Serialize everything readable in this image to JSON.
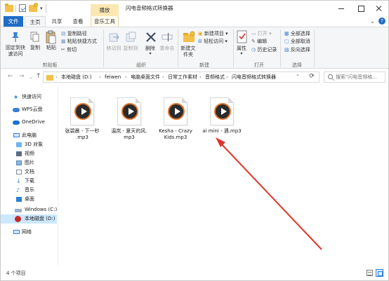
{
  "window": {
    "context_tab": "播放",
    "title": "闪电音频格式转换器"
  },
  "tabs": [
    "文件",
    "主页",
    "共享",
    "查看",
    "音乐工具"
  ],
  "ribbon": {
    "clipboard": {
      "pin_label": "固定到快速访问",
      "copy_label": "复制",
      "paste_label": "粘贴",
      "copy_path": "复制路径",
      "paste_shortcut": "粘贴快捷方式",
      "cut": "剪切",
      "group": "剪贴板"
    },
    "organize": {
      "move_to": "移动到",
      "copy_to": "复制到",
      "delete": "删除",
      "rename": "重命名",
      "group": "组织"
    },
    "new": {
      "new_folder": "新建文件夹",
      "new_item": "新建项目",
      "easy_access": "轻松访问",
      "group": "新建"
    },
    "open": {
      "properties": "属性",
      "open": "打开",
      "edit": "编辑",
      "history": "历史记录",
      "group": "打开"
    },
    "select": {
      "select_all": "全部选择",
      "select_none": "全部取消",
      "invert": "反向选择",
      "group": "选择"
    }
  },
  "address": {
    "crumbs": [
      "本地磁盘 (D:)",
      "feiwen",
      "电脑桌面文件",
      "日常工作素材",
      "音频格式",
      "闪电音频格式转换器"
    ],
    "search_placeholder": "搜索\"闪电音频格..."
  },
  "nav": {
    "items": [
      {
        "label": "快速访问",
        "icon": "star-icon"
      },
      {
        "label": "WPS云盘",
        "icon": "cloud-icon"
      },
      {
        "label": "OneDrive",
        "icon": "onedrive-icon"
      },
      {
        "label": "此电脑",
        "icon": "computer-icon"
      },
      {
        "label": "3D 对象",
        "icon": "cube-icon"
      },
      {
        "label": "视频",
        "icon": "video-icon"
      },
      {
        "label": "图片",
        "icon": "picture-icon"
      },
      {
        "label": "文档",
        "icon": "document-icon"
      },
      {
        "label": "下载",
        "icon": "download-icon"
      },
      {
        "label": "音乐",
        "icon": "music-icon"
      },
      {
        "label": "桌面",
        "icon": "desktop-icon"
      },
      {
        "label": "Windows (C:)",
        "icon": "drive-icon"
      },
      {
        "label": "本地磁盘 (D:)",
        "icon": "drive-icon"
      },
      {
        "label": "网络",
        "icon": "network-icon"
      }
    ]
  },
  "files": [
    {
      "line1": "张碧晨 - 下一秒",
      "line2": ".mp3"
    },
    {
      "line1": "温岚 - 夏天的风.",
      "line2": "mp3"
    },
    {
      "line1": "Kesha - Crazy",
      "line2": "Kids.mp3"
    },
    {
      "line1": "ai mini - 遇.mp3",
      "line2": ""
    }
  ],
  "status": {
    "text": "4 个项目"
  },
  "colors": {
    "accent": "#1f6dc7",
    "context_tab": "#fbe7b2",
    "selection": "#cce8ff",
    "annotation_arrow": "#e0352b",
    "play_ring": "#e2752f"
  }
}
